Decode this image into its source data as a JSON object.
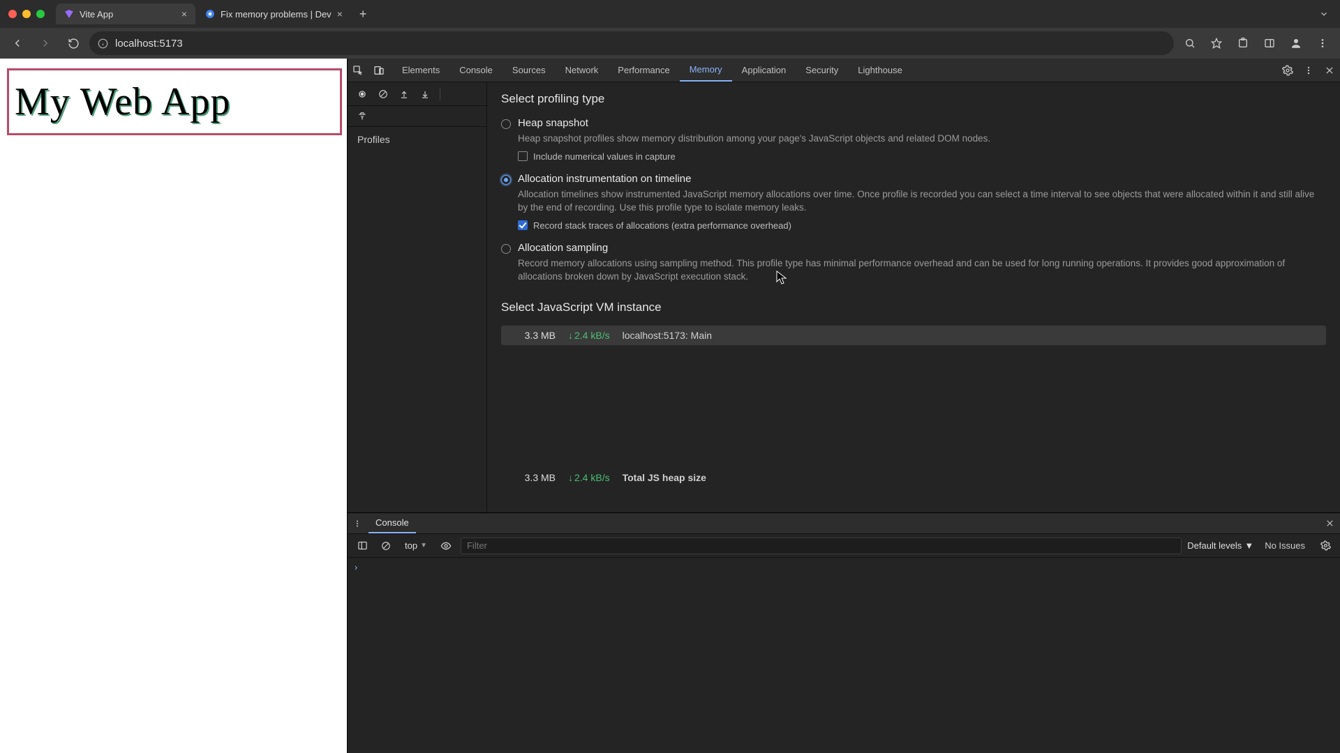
{
  "browser": {
    "tabs": [
      {
        "title": "Vite App",
        "favicon": "vite"
      },
      {
        "title": "Fix memory problems  |  Dev",
        "favicon": "chrome"
      }
    ],
    "url": "localhost:5173"
  },
  "page": {
    "heading": "My Web App"
  },
  "devtools": {
    "tabs": [
      "Elements",
      "Console",
      "Sources",
      "Network",
      "Performance",
      "Memory",
      "Application",
      "Security",
      "Lighthouse"
    ],
    "active_tab": "Memory",
    "left_panel_label": "Profiles",
    "section_profiling_type": "Select profiling type",
    "options": {
      "heap": {
        "label": "Heap snapshot",
        "desc": "Heap snapshot profiles show memory distribution among your page's JavaScript objects and related DOM nodes.",
        "sub_label": "Include numerical values in capture",
        "sub_checked": false,
        "selected": false
      },
      "timeline": {
        "label": "Allocation instrumentation on timeline",
        "desc": "Allocation timelines show instrumented JavaScript memory allocations over time. Once profile is recorded you can select a time interval to see objects that were allocated within it and still alive by the end of recording. Use this profile type to isolate memory leaks.",
        "sub_label": "Record stack traces of allocations (extra performance overhead)",
        "sub_checked": true,
        "selected": true
      },
      "sampling": {
        "label": "Allocation sampling",
        "desc": "Record memory allocations using sampling method. This profile type has minimal performance overhead and can be used for long running operations. It provides good approximation of allocations broken down by JavaScript execution stack.",
        "selected": false
      }
    },
    "section_vm": "Select JavaScript VM instance",
    "vm_instances": [
      {
        "size": "3.3 MB",
        "rate": "2.4 kB/s",
        "name": "localhost:5173: Main"
      }
    ],
    "vm_total": {
      "size": "3.3 MB",
      "rate": "2.4 kB/s",
      "name": "Total JS heap size"
    }
  },
  "console": {
    "drawer_tab": "Console",
    "context": "top",
    "filter_placeholder": "Filter",
    "levels": "Default levels",
    "issues": "No Issues",
    "prompt": "›"
  },
  "colors": {
    "accent": "#8ab4f8",
    "green": "#4bbf73",
    "hero_border": "#b84a6a",
    "hero_shadow": "#4a9c7a"
  }
}
